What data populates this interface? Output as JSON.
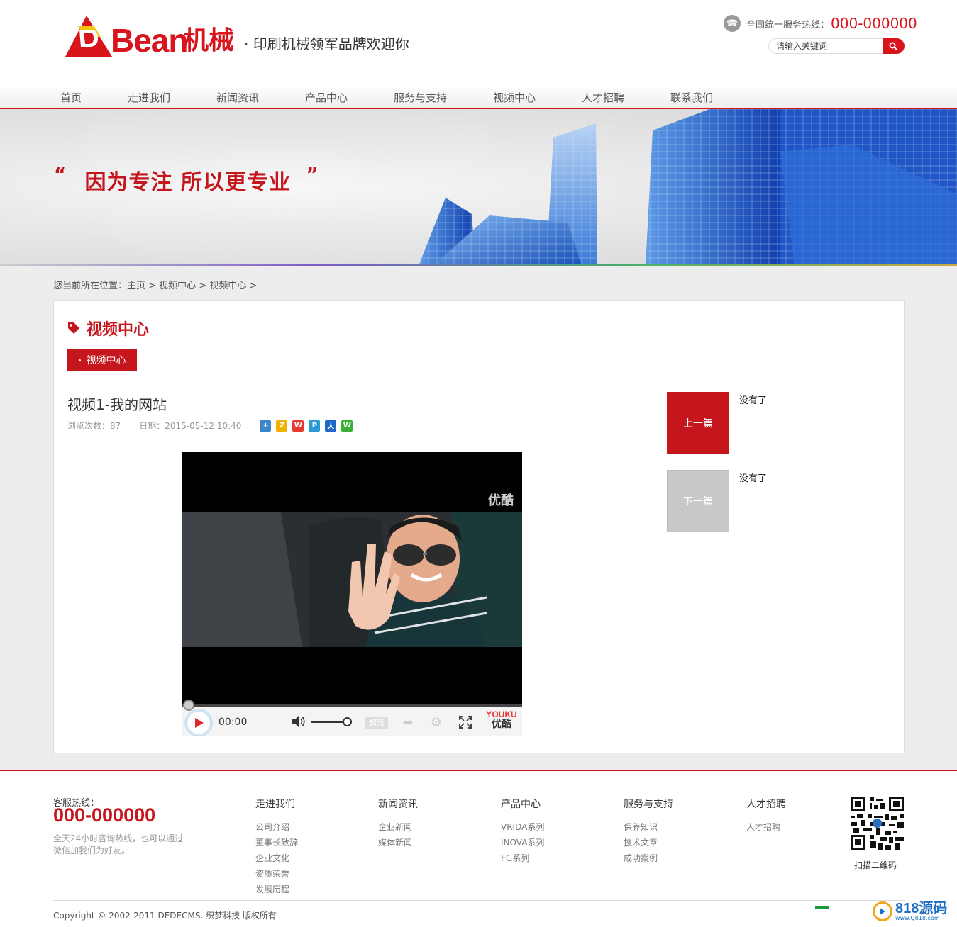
{
  "header": {
    "logo_text": "Bean",
    "logo_cn": "机械",
    "slogan": "· 印刷机械领军品牌欢迎你",
    "hotline_label": "全国统一服务热线：",
    "hotline_number": "000-000000",
    "search_placeholder": "请输入关键词"
  },
  "nav": {
    "items": [
      "首页",
      "走进我们",
      "新闻资讯",
      "产品中心",
      "服务与支持",
      "视频中心",
      "人才招聘",
      "联系我们"
    ]
  },
  "banner": {
    "quote_open": "“",
    "slogan": "因为专注 所以更专业",
    "quote_close": "”"
  },
  "breadcrumb": {
    "text": "您当前所在位置：主页 > 视频中心 > 视频中心 >"
  },
  "section": {
    "title": "视频中心",
    "subnav_label": "视频中心"
  },
  "article": {
    "title": "视频1-我的网站",
    "views_label": "浏览次数：87",
    "date_label": "日期：2015-05-12 10:40",
    "share_icons": [
      "share-plus-icon",
      "qzone-icon",
      "weibo-icon",
      "tencent-weibo-icon",
      "renren-icon",
      "wechat-icon"
    ]
  },
  "video": {
    "watermark": "优酷",
    "time": "00:00",
    "quality_label": "超清",
    "youku_brand": "YOUKU",
    "youku_cn": "优酷",
    "progress": 0,
    "volume": 1.0
  },
  "pager": {
    "prev_label": "上一篇",
    "prev_text": "没有了",
    "next_label": "下一篇",
    "next_text": "没有了"
  },
  "footer": {
    "hotline_label": "客服热线：",
    "hotline_number": "000-000000",
    "hotline_desc": "全天24小时咨询热线，也可以通过微信加我们为好友。",
    "columns": [
      {
        "title": "走进我们",
        "links": [
          "公司介绍",
          "董事长致辞",
          "企业文化",
          "资质荣誉",
          "发展历程"
        ]
      },
      {
        "title": "新闻资讯",
        "links": [
          "企业新闻",
          "媒体新闻"
        ]
      },
      {
        "title": "产品中心",
        "links": [
          "VRIDA系列",
          "INOVA系列",
          "FG系列"
        ]
      },
      {
        "title": "服务与支持",
        "links": [
          "保养知识",
          "技术文章",
          "成功案例"
        ]
      },
      {
        "title": "人才招聘",
        "links": [
          "人才招聘"
        ]
      }
    ],
    "qr_label": "扫描二维码",
    "copyright": "Copyright © 2002-2011 DEDECMS. 织梦科技 版权所有",
    "brand_text": "818源码",
    "brand_url": "www.Q818.com"
  },
  "colors": {
    "accent": "#c4161c",
    "logo_red": "#d8141c",
    "next_disabled": "#c8c8c8"
  }
}
